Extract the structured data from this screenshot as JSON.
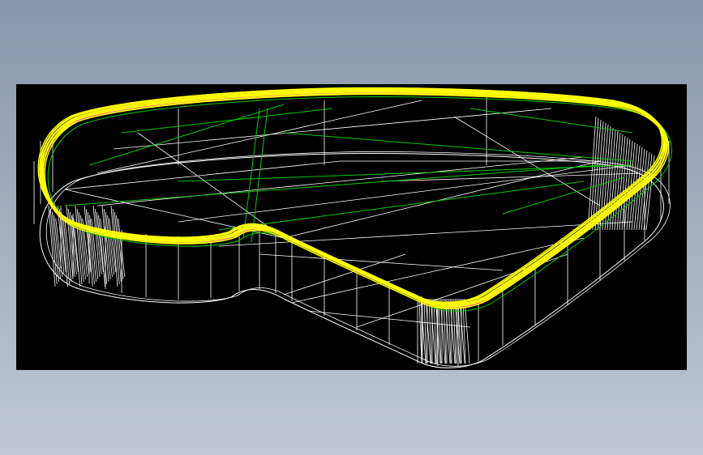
{
  "viewport": {
    "background": "#000000",
    "page_gradient": [
      "#8797ab",
      "#a3afbf",
      "#c1c7d2"
    ]
  },
  "model": {
    "wire_color": "#ffffff",
    "rim_color": "#ffff00",
    "accent_color": "#ff00ff",
    "inner_color": "#00cc00"
  }
}
